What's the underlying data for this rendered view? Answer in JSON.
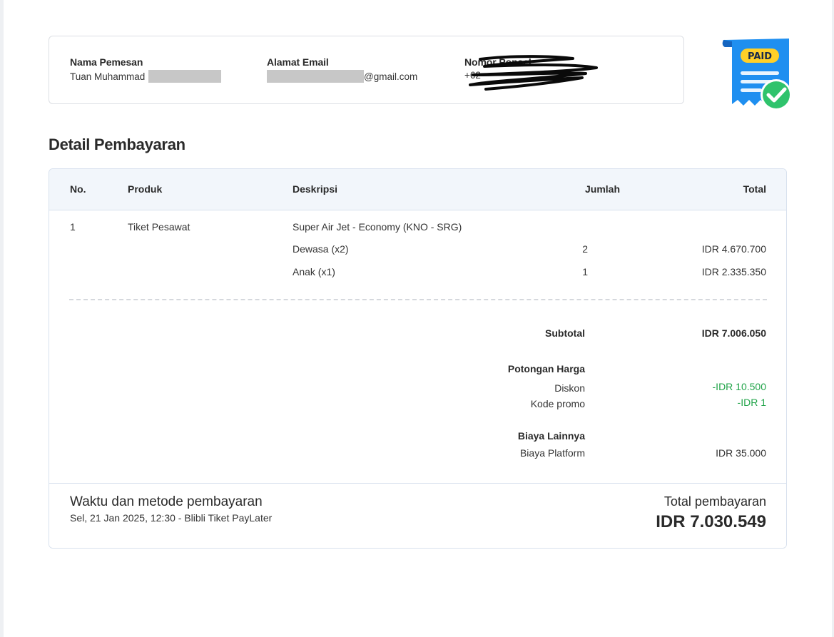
{
  "customer": {
    "name_label": "Nama Pemesan",
    "name_value": "Tuan Muhammad",
    "email_label": "Alamat Email",
    "email_value": "@gmail.com",
    "phone_label": "Nomor Ponsel",
    "phone_value": "+62"
  },
  "badge": {
    "text": "PAID",
    "icon": "paid-receipt-check-icon"
  },
  "section_title": "Detail Pembayaran",
  "table": {
    "headers": {
      "no": "No.",
      "product": "Produk",
      "description": "Deskripsi",
      "quantity": "Jumlah",
      "total": "Total"
    },
    "row": {
      "no": "1",
      "product": "Tiket Pesawat",
      "description": "Super Air Jet - Economy (KNO - SRG)",
      "items": [
        {
          "description": "Dewasa (x2)",
          "quantity": "2",
          "total": "IDR 4.670.700"
        },
        {
          "description": "Anak (x1)",
          "quantity": "1",
          "total": "IDR 2.335.350"
        }
      ]
    }
  },
  "summary": {
    "subtotal_label": "Subtotal",
    "subtotal_value": "IDR 7.006.050",
    "discount_heading": "Potongan Harga",
    "discount_label": "Diskon",
    "discount_value": "-IDR 10.500",
    "promo_label": "Kode promo",
    "promo_value": "-IDR 1",
    "other_heading": "Biaya Lainnya",
    "platform_label": "Biaya Platform",
    "platform_value": "IDR 35.000"
  },
  "payment": {
    "title": "Waktu dan metode pembayaran",
    "detail": "Sel, 21 Jan 2025, 12:30 - Blibli Tiket PayLater",
    "total_label": "Total pembayaran",
    "total_value": "IDR 7.030.549"
  },
  "colors": {
    "accent_green": "#22a44a",
    "paid_blue": "#1f8ff0",
    "paid_yellow": "#ffd028"
  }
}
